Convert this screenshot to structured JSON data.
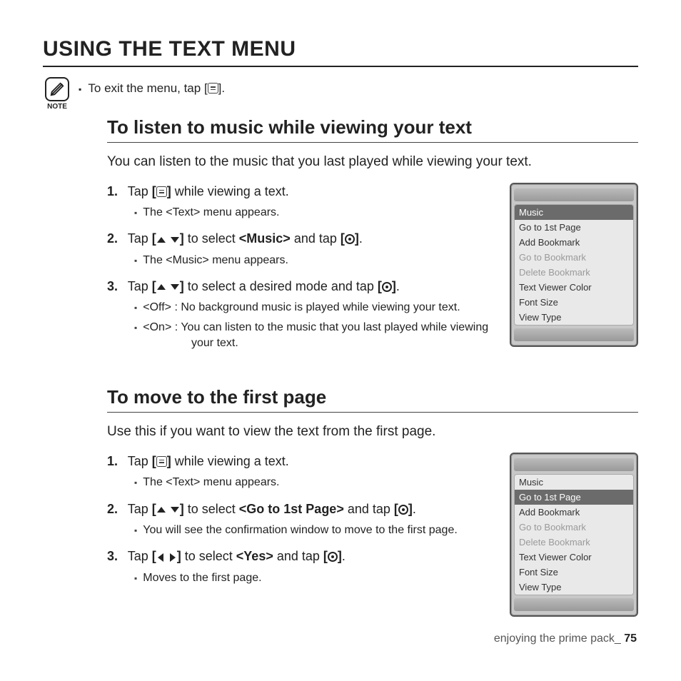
{
  "title": "USING THE TEXT MENU",
  "note": {
    "label": "NOTE",
    "text_before": "To exit the menu, tap [",
    "text_after": "]."
  },
  "section1": {
    "heading": "To listen to music while viewing your text",
    "intro": "You can listen to the music that you last played while viewing your text.",
    "steps": {
      "s1_a": "Tap ",
      "s1_b": " while viewing a text.",
      "s1_sub": "The <Text> menu appears.",
      "s2_a": "Tap ",
      "s2_b": " to select ",
      "s2_target": "<Music>",
      "s2_c": " and tap ",
      "s2_sub": "The <Music> menu appears.",
      "s3_a": "Tap ",
      "s3_b": " to select a desired mode and tap ",
      "s3_sub1": "<Off> : No background music is played while viewing your text.",
      "s3_sub2": "<On> : You can listen to the music that you last played while viewing your text."
    },
    "menu": {
      "highlight": "Music",
      "items": [
        {
          "label": "Go to 1st Page",
          "dim": false
        },
        {
          "label": "Add Bookmark",
          "dim": false
        },
        {
          "label": "Go to Bookmark",
          "dim": true
        },
        {
          "label": "Delete Bookmark",
          "dim": true
        },
        {
          "label": "Text Viewer Color",
          "dim": false
        },
        {
          "label": "Font Size",
          "dim": false
        },
        {
          "label": "View Type",
          "dim": false
        }
      ]
    }
  },
  "section2": {
    "heading": "To move to the first page",
    "intro": "Use this if you want to view the text from the first page.",
    "steps": {
      "s1_a": "Tap ",
      "s1_b": " while viewing a text.",
      "s1_sub": "The <Text> menu appears.",
      "s2_a": "Tap ",
      "s2_b": " to select ",
      "s2_target": "<Go to 1st Page>",
      "s2_c": " and tap ",
      "s2_sub": "You will see the confirmation window to move to the first page.",
      "s3_a": "Tap ",
      "s3_b": " to select ",
      "s3_target": "<Yes>",
      "s3_c": " and tap ",
      "s3_sub": "Moves to the first page."
    },
    "menu": {
      "top": "Music",
      "highlight": "Go to 1st Page",
      "items": [
        {
          "label": "Add Bookmark",
          "dim": false
        },
        {
          "label": "Go to Bookmark",
          "dim": true
        },
        {
          "label": "Delete Bookmark",
          "dim": true
        },
        {
          "label": "Text Viewer Color",
          "dim": false
        },
        {
          "label": "Font Size",
          "dim": false
        },
        {
          "label": "View Type",
          "dim": false
        }
      ]
    }
  },
  "footer": {
    "text": "enjoying the prime pack_ ",
    "page": "75"
  }
}
